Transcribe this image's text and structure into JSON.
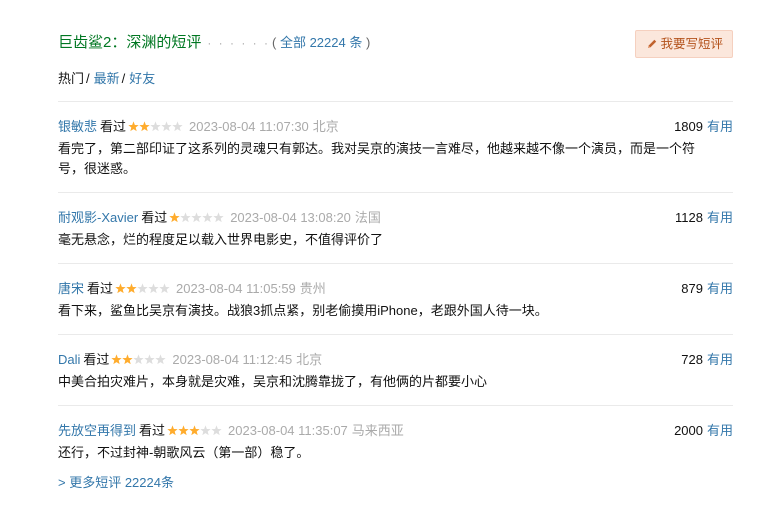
{
  "header": {
    "title": "巨齿鲨2：深渊的短评",
    "dots": "· · · · · ·",
    "all_prefix": "( ",
    "all_link": "全部 22224 条",
    "all_suffix": " )",
    "write_button": "我要写短评"
  },
  "tabs": {
    "hot": "热门",
    "latest": "最新",
    "friends": "好友"
  },
  "comments": [
    {
      "user": "银敏悲",
      "status": "看过",
      "rating": 2,
      "time": "2023-08-04 11:07:30",
      "location": "北京",
      "votes": "1809",
      "useful": "有用",
      "text": "看完了，第二部印证了这系列的灵魂只有郭达。我对吴京的演技一言难尽，他越来越不像一个演员，而是一个符号，很迷惑。"
    },
    {
      "user": "耐观影-Xavier",
      "status": "看过",
      "rating": 1,
      "time": "2023-08-04 13:08:20",
      "location": "法国",
      "votes": "1128",
      "useful": "有用",
      "text": "毫无悬念，烂的程度足以载入世界电影史，不值得评价了"
    },
    {
      "user": "唐宋",
      "status": "看过",
      "rating": 2,
      "time": "2023-08-04 11:05:59",
      "location": "贵州",
      "votes": "879",
      "useful": "有用",
      "text": "看下来，鲨鱼比吴京有演技。战狼3抓点紧，别老偷摸用iPhone，老跟外国人待一块。"
    },
    {
      "user": "Dali",
      "status": "看过",
      "rating": 2,
      "time": "2023-08-04 11:12:45",
      "location": "北京",
      "votes": "728",
      "useful": "有用",
      "text": "中美合拍灾难片，本身就是灾难，吴京和沈腾靠拢了，有他俩的片都要小心"
    },
    {
      "user": "先放空再得到",
      "status": "看过",
      "rating": 3,
      "time": "2023-08-04 11:35:07",
      "location": "马来西亚",
      "votes": "2000",
      "useful": "有用",
      "text": "还行，不过封神-朝歌风云（第一部）稳了。"
    }
  ],
  "more_link": "> 更多短评 22224条",
  "colors": {
    "title_green": "#007722",
    "link_blue": "#3377aa",
    "star_on": "#ffac2d",
    "star_off": "#dddddd",
    "button_bg": "#fbe7dc",
    "button_text": "#b4531c"
  }
}
